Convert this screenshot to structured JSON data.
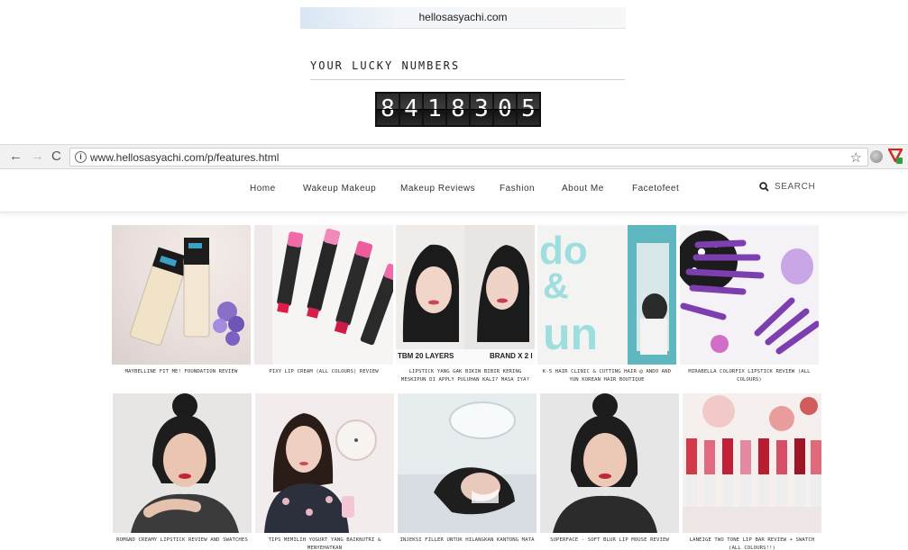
{
  "banner": {
    "domain": "hellosasyachi.com"
  },
  "lucky": {
    "title": "YOUR LUCKY NUMBERS",
    "digits": [
      "8",
      "4",
      "1",
      "8",
      "3",
      "0",
      "5"
    ]
  },
  "browser": {
    "url": "www.hellosasyachi.com/p/features.html",
    "back_icon": "←",
    "forward_icon": "→",
    "reload_icon": "C",
    "info_icon": "i",
    "star_icon": "☆"
  },
  "nav": {
    "items": [
      "Home",
      "Wakeup Makeup",
      "Makeup Reviews",
      "Fashion",
      "About Me",
      "Facetofeet"
    ],
    "search_label": "SEARCH"
  },
  "posts": [
    {
      "caption": "MAYBELLINE FIT ME! FOUNDATION REVIEW",
      "overlay": "",
      "overlay2": ""
    },
    {
      "caption": "PIXY LIP CREAM (ALL COLOURS) REVIEW",
      "overlay": "",
      "overlay2": ""
    },
    {
      "caption": "LIPSTICK YANG GAK BIKIN BIBIR KERING MESKIPUN DI APPLY PULUHAN KALI? MASA IYA?",
      "overlay": "TBM 20 LAYERS",
      "overlay2": "BRAND X 2 l"
    },
    {
      "caption": "K-5 HAIR CLINIC & CUTTING HAIR @ ANDO AND YUN KOREAN HAIR BOUTIQUE",
      "overlay": "",
      "overlay2": ""
    },
    {
      "caption": "MIRABELLA COLORFIX LIPSTICK REVIEW (ALL COLOURS)",
      "overlay": "",
      "overlay2": ""
    },
    {
      "caption": "ROM&ND CREAMY LIPSTICK REVIEW AND SWATCHES",
      "overlay": "",
      "overlay2": ""
    },
    {
      "caption": "TIPS MEMILIH YOGURT YANG BAIKNUTRI & MENYEHATKAN",
      "overlay": "",
      "overlay2": ""
    },
    {
      "caption": "INJEKSI FILLER UNTUK HILANGKAN KANTONG MATA",
      "overlay": "",
      "overlay2": ""
    },
    {
      "caption": "SUPERFACE - SOFT BLUR LIP MOUSE REVIEW",
      "overlay": "",
      "overlay2": ""
    },
    {
      "caption": "LANEIGE TWO TONE LIP BAR REVIEW + SWATCH (ALL COLOURS!!)",
      "overlay": "",
      "overlay2": ""
    }
  ],
  "ando_text": {
    "line1": "do",
    "line2": "&",
    "line3": "un"
  }
}
